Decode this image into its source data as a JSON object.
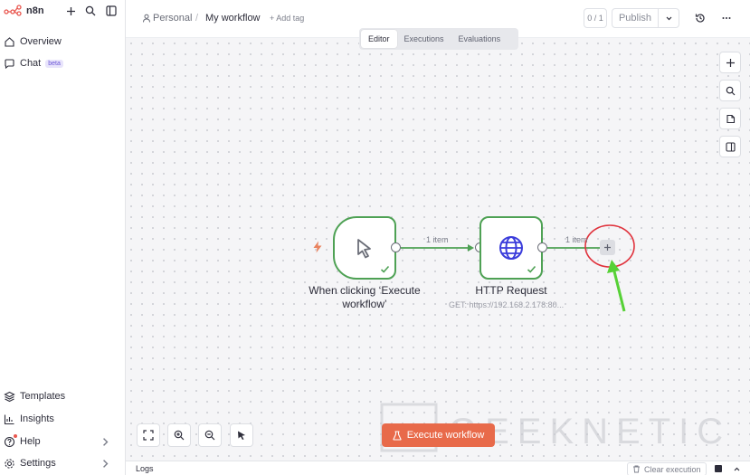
{
  "app": {
    "brand": "n8n"
  },
  "sidebar": {
    "items": [
      {
        "label": "Overview",
        "icon": "home-icon"
      },
      {
        "label": "Chat",
        "badge": "beta",
        "icon": "chat-icon"
      }
    ],
    "bottom_items": [
      {
        "label": "Templates",
        "icon": "templates-icon"
      },
      {
        "label": "Insights",
        "icon": "insights-icon"
      },
      {
        "label": "Help",
        "icon": "help-icon"
      },
      {
        "label": "Settings",
        "icon": "gear-icon"
      }
    ]
  },
  "header": {
    "project": "Personal",
    "separator": "/",
    "workflow_name": "My workflow",
    "add_tag": "+ Add tag",
    "counter": "0 / 1",
    "publish": "Publish"
  },
  "tabs": [
    {
      "label": "Editor",
      "active": true
    },
    {
      "label": "Executions",
      "active": false
    },
    {
      "label": "Evaluations",
      "active": false
    }
  ],
  "nodes": {
    "trigger": {
      "label": "When clicking ‘Execute workflow’",
      "icon": "cursor-icon"
    },
    "http": {
      "label": "HTTP Request",
      "subtitle": "GET: https://192.168.2.178:80...",
      "icon": "globe-icon"
    }
  },
  "edges": {
    "first_label": "1 item",
    "second_label": "1 item"
  },
  "canvas": {
    "execute_button": "Execute workflow"
  },
  "logs": {
    "title": "Logs",
    "clear": "Clear execution"
  },
  "watermark": {
    "text": "GEEKNETIC"
  },
  "colors": {
    "accent": "#e86a4a",
    "success": "#4ea154",
    "annotation_circle": "#e0323c",
    "annotation_arrow": "#56d136"
  }
}
